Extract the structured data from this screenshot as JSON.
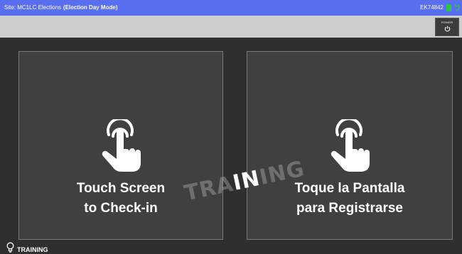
{
  "titlebar": {
    "site_text": "Site: MC1LC Elections",
    "mode_text": "(Election Day Mode)",
    "device_id": "EK74842",
    "color": "#5a6ef0"
  },
  "toolbar": {
    "power_label": "POWER",
    "power_icon": "power-icon"
  },
  "panels": {
    "english": {
      "line1": "Touch Screen",
      "line2": "to Check-in",
      "icon": "tap-hand-icon"
    },
    "spanish": {
      "line1": "Toque la Pantalla",
      "line2": "para Registrarse",
      "icon": "tap-hand-icon"
    }
  },
  "watermark": {
    "left": "TRA",
    "middle": "IN",
    "right": "ING"
  },
  "footer": {
    "mode_text": "TRAINING",
    "icon": "lightbulb-icon"
  }
}
